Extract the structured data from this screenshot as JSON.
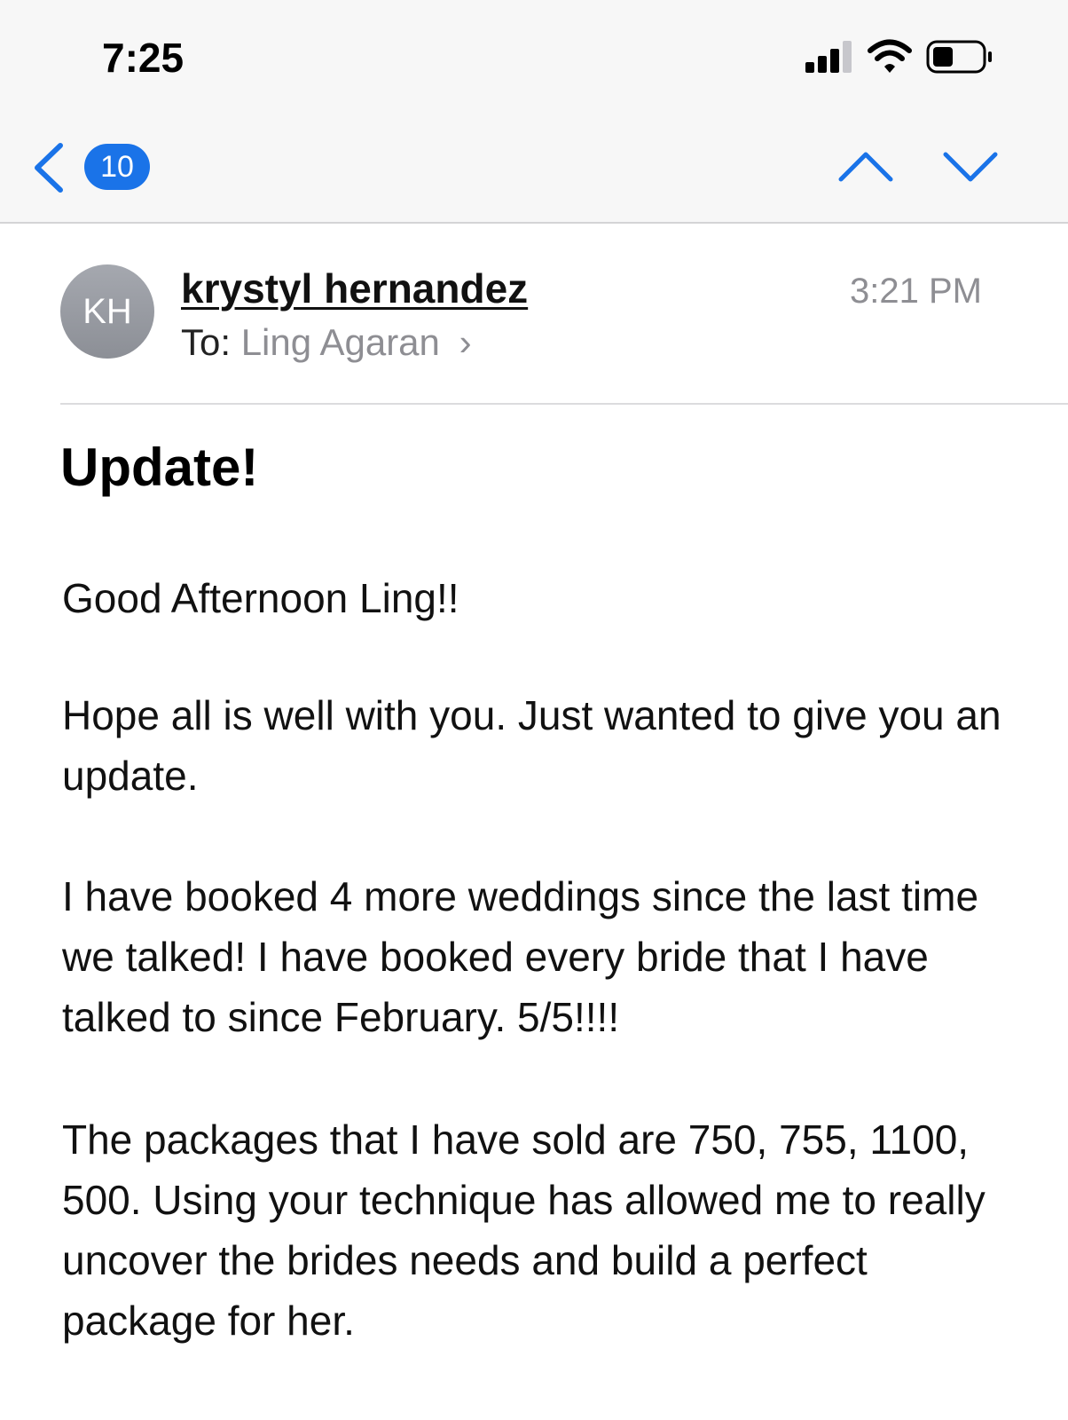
{
  "status_bar": {
    "time": "7:25",
    "icons": [
      "cellular-signal-icon",
      "wifi-icon",
      "battery-icon"
    ]
  },
  "nav": {
    "back_icon": "chevron-left-icon",
    "unread_count": "10",
    "up_icon": "chevron-up-icon",
    "down_icon": "chevron-down-icon",
    "accent_color": "#1a73e8"
  },
  "message": {
    "avatar_initials": "KH",
    "sender": "krystyl hernandez",
    "to_label": "To:",
    "recipient": "Ling Agaran",
    "time": "3:21 PM",
    "subject": "Update!",
    "paragraphs": [
      "Good Afternoon Ling!!",
      "Hope all is well with you. Just wanted to give you an update.",
      "I have booked 4 more weddings since the last time we talked! I have booked every bride that I have talked to since February. 5/5!!!!",
      "The packages that I have sold are 750, 755, 1100, 500. Using your technique has allowed me to really uncover the brides needs and build a perfect package for her."
    ]
  }
}
